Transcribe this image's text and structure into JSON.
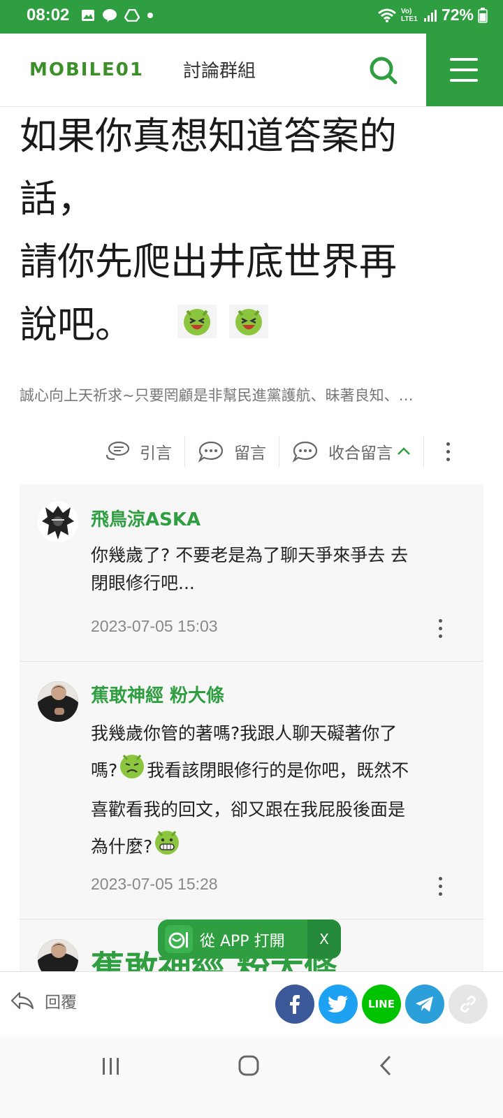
{
  "status_bar": {
    "time": "08:02",
    "net_label": "Vo) LTE1",
    "battery": "72%"
  },
  "header": {
    "logo_text": "MOBILE01",
    "title": "討論群組"
  },
  "post": {
    "lines": [
      "如果你真想知道答案的",
      "話，",
      "請你先爬出井底世界再",
      "說吧。"
    ],
    "signature": "誠心向上天祈求~只要罔顧是非幫民進黨護航、昧著良知、…"
  },
  "actions": {
    "quote": "引言",
    "comment": "留言",
    "collapse": "收合留言"
  },
  "comments": [
    {
      "name": "飛鳥涼ASKA",
      "lines": [
        "你幾歲了? 不要老是為了聊天爭來爭去 去",
        "閉眼修行吧..."
      ],
      "time": "2023-07-05 15:03"
    },
    {
      "name": "蕉敢神經 粉大條",
      "lines": [
        "我幾歲你管的著嗎?我跟人聊天礙著你了",
        "嗎?",
        "我看該閉眼修行的是你吧，既然不",
        "喜歡看我的回文，卻又跟在我屁股後面是",
        "為什麼?"
      ],
      "time": "2023-07-05 15:28"
    },
    {
      "name": "蕉敢神經 粉大條"
    }
  ],
  "app_banner": {
    "label": "從 APP 打開",
    "close": "X"
  },
  "share_bar": {
    "reply": "回覆",
    "line": "LINE"
  },
  "colors": {
    "brand_green": "#2f9e41",
    "facebook": "#3b5998",
    "twitter": "#1da1f2",
    "line": "#00c300",
    "telegram": "#2a9fd9"
  }
}
